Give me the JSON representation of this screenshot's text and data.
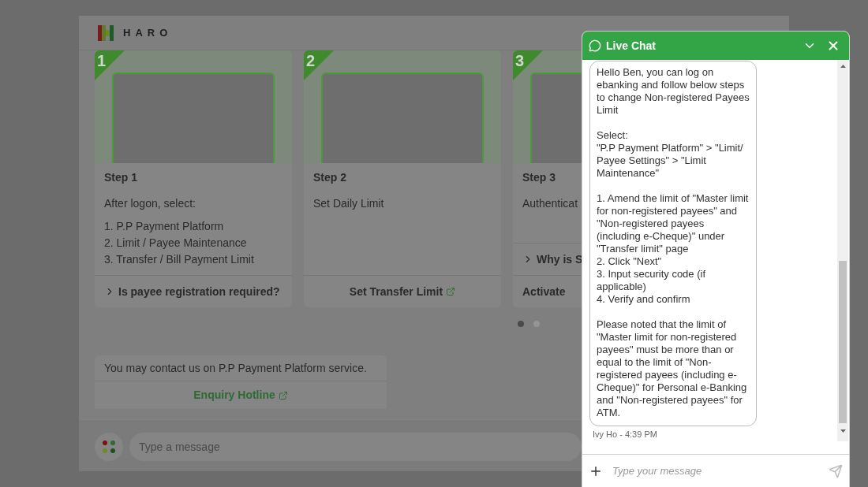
{
  "header": {
    "logo_text": "HARO"
  },
  "steps": [
    {
      "number": "1",
      "title": "Step 1",
      "intro": "After logon, select:",
      "items": [
        "1. P.P Payment Platform",
        "2. Limit / Payee Maintenance",
        "3. Transfer / Bill Payment Limit"
      ],
      "footer": {
        "kind": "expand",
        "label": "Is payee registration required?"
      }
    },
    {
      "number": "2",
      "title": "Step 2",
      "intro": "Set Daily Limit",
      "footer": {
        "kind": "link",
        "label": "Set Transfer Limit"
      }
    },
    {
      "number": "3",
      "title": "Step 3",
      "intro": "Authenticat",
      "extra": "Why is S",
      "footer": {
        "kind": "plain",
        "label": "Activate"
      }
    }
  ],
  "pager": [
    {
      "selected": true
    },
    {
      "selected": false
    }
  ],
  "bot_message": {
    "text": "You may contact us on P.P Payment Platform service.",
    "link": "Enquiry Hotline"
  },
  "composer": {
    "placeholder": "Type a message"
  },
  "live_chat": {
    "title": "Live Chat",
    "message": {
      "text": "Hello Ben, you can log on ebanking and follow below steps to change Non-registered Payees Limit\n\nSelect:\n\"P.P Payment Platform\" > \"Limit/ Payee Settings\" > \"Limit Maintenance\"\n\n1. Amend the limit of \"Master limit for non-registered payees\" and \"Non-registered payees (including e-Cheque)\" under \"Transfer limit\" page\n2. Click \"Next\"\n3. Input security code (if applicable)\n4. Verify and confirm\n\nPlease noted that the limit of \"Master limit for non-registered payees\" must be more than or equal to the limit of \"Non-registered payees (including e-Cheque)\" for Personal e-Banking and \"Non-registered payees\" for ATM.",
      "meta": "Ivy Ho - 4:39 PM"
    },
    "input_placeholder": "Type your message"
  }
}
